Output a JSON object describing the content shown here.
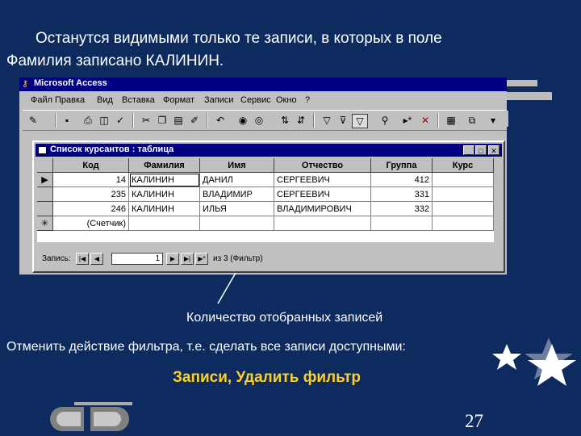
{
  "slide": {
    "intro_line1": "Останутся видимыми только те записи, в которых в поле",
    "intro_line2": "Фамилия записано КАЛИНИН.",
    "caption": "Количество отобранных записей",
    "undo_text": "Отменить действие фильтра, т.е. сделать все записи доступными:",
    "menu_path": "Записи, Удалить фильтр",
    "page_number": "27",
    "accent_color": "#ffd21c",
    "background_color": "#0d2b5e"
  },
  "app": {
    "title": "Microsoft Access",
    "menu": [
      "Файл",
      "Правка",
      "Вид",
      "Вставка",
      "Формат",
      "Записи",
      "Сервис",
      "Окно",
      "?"
    ],
    "toolbar_icons": [
      "view-icon",
      "save-icon",
      "print-icon",
      "preview-icon",
      "spell-icon",
      "cut-icon",
      "copy-icon",
      "paste-icon",
      "format-painter-icon",
      "undo-icon",
      "hyperlink-icon",
      "web-icon",
      "sort-asc-icon",
      "sort-desc-icon",
      "filter-selection-icon",
      "filter-form-icon",
      "apply-filter-icon",
      "find-icon",
      "new-record-icon",
      "delete-record-icon",
      "properties-icon",
      "database-window-icon",
      "new-object-icon",
      "help-icon"
    ]
  },
  "table": {
    "title": "Список курсантов : таблица",
    "columns": [
      "Код",
      "Фамилия",
      "Имя",
      "Отчество",
      "Группа",
      "Курс"
    ],
    "rows": [
      {
        "code": "14",
        "surname": "КАЛИНИН",
        "name": "ДАНИЛ",
        "patronymic": "СЕРГЕЕВИЧ",
        "group": "412",
        "course": ""
      },
      {
        "code": "235",
        "surname": "КАЛИНИН",
        "name": "ВЛАДИМИР",
        "patronymic": "СЕРГЕЕВИЧ",
        "group": "331",
        "course": ""
      },
      {
        "code": "246",
        "surname": "КАЛИНИН",
        "name": "ИЛЬЯ",
        "patronymic": "ВЛАДИМИРОВИЧ",
        "group": "332",
        "course": ""
      }
    ],
    "new_row_placeholder": "(Счетчик)",
    "nav": {
      "label": "Запись:",
      "current": "1",
      "total_text": "из 3 (Фильтр)"
    }
  }
}
